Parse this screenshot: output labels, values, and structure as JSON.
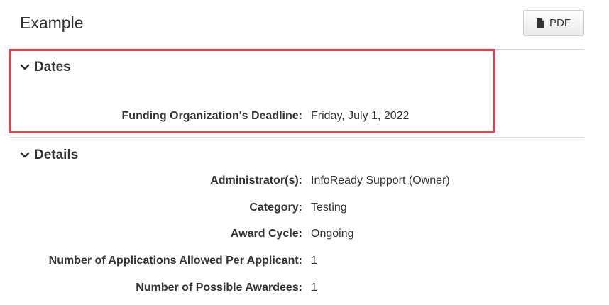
{
  "header": {
    "title": "Example",
    "pdf_label": "PDF",
    "pdf_icon": "file-icon"
  },
  "sections": {
    "dates": {
      "title": "Dates",
      "toggle_icon": "chevron-down-icon",
      "rows": [
        {
          "label": "Funding Organization's Deadline",
          "value": "Friday, July 1, 2022"
        }
      ]
    },
    "details": {
      "title": "Details",
      "toggle_icon": "chevron-down-icon",
      "rows": [
        {
          "label": "Administrator(s)",
          "value": "InfoReady Support (Owner)"
        },
        {
          "label": "Category",
          "value": "Testing"
        },
        {
          "label": "Award Cycle",
          "value": "Ongoing"
        },
        {
          "label": "Number of Applications Allowed Per Applicant",
          "value": "1"
        },
        {
          "label": "Number of Possible Awardees",
          "value": "1"
        }
      ]
    }
  },
  "colors": {
    "highlight_border": "#e8414e",
    "divider": "#d9d9d9",
    "text": "#333333"
  }
}
